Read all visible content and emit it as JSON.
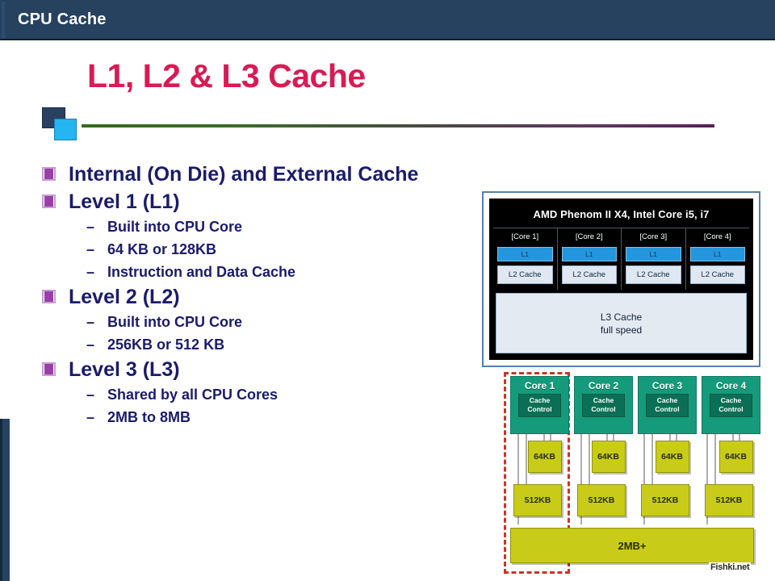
{
  "header": {
    "title": "CPU Cache"
  },
  "slide": {
    "title": "L1, L2 & L3 Cache"
  },
  "bullets": [
    {
      "level": 1,
      "text": "Internal (On Die) and External Cache"
    },
    {
      "level": 1,
      "text": "Level 1 (L1)"
    },
    {
      "level": 2,
      "text": "Built into CPU Core"
    },
    {
      "level": 2,
      "text": "64 KB or 128KB"
    },
    {
      "level": 2,
      "text": "Instruction and Data Cache"
    },
    {
      "level": 1,
      "text": "Level 2 (L2)"
    },
    {
      "level": 2,
      "text": "Built into CPU Core"
    },
    {
      "level": 2,
      "text": "256KB or 512 KB"
    },
    {
      "level": 1,
      "text": "Level 3 (L3)"
    },
    {
      "level": 2,
      "text": "Shared by all CPU Cores"
    },
    {
      "level": 2,
      "text": "2MB to 8MB"
    }
  ],
  "diagram_top": {
    "title": "AMD Phenom II X4, Intel Core i5, i7",
    "cores": [
      {
        "label": "[Core 1]",
        "l1": "L1",
        "l2": "L2 Cache"
      },
      {
        "label": "[Core 2]",
        "l1": "L1",
        "l2": "L2 Cache"
      },
      {
        "label": "[Core 3]",
        "l1": "L1",
        "l2": "L2 Cache"
      },
      {
        "label": "[Core 4]",
        "l1": "L1",
        "l2": "L2 Cache"
      }
    ],
    "l3_line1": "L3 Cache",
    "l3_line2": "full speed"
  },
  "diagram_bottom": {
    "cores": [
      {
        "label": "Core 1",
        "control_line1": "Cache",
        "control_line2": "Control",
        "l1": "64KB",
        "l2": "512KB"
      },
      {
        "label": "Core 2",
        "control_line1": "Cache",
        "control_line2": "Control",
        "l1": "64KB",
        "l2": "512KB"
      },
      {
        "label": "Core 3",
        "control_line1": "Cache",
        "control_line2": "Control",
        "l1": "64KB",
        "l2": "512KB"
      },
      {
        "label": "Core 4",
        "control_line1": "Cache",
        "control_line2": "Control",
        "l1": "64KB",
        "l2": "512KB"
      }
    ],
    "shared": "2MB+"
  },
  "watermark": {
    "text": "Fishki.net"
  },
  "colors": {
    "header_bg": "#26425f",
    "title_pink": "#d81b54",
    "body_navy": "#1b1b6b",
    "bullet_purple": "#9b3fa8",
    "accent_cyan": "#25b5f0",
    "core_green": "#159b7b",
    "cache_yellow": "#c8cc18",
    "dashed_red": "#c0392b",
    "l1_blue": "#2496dd"
  }
}
